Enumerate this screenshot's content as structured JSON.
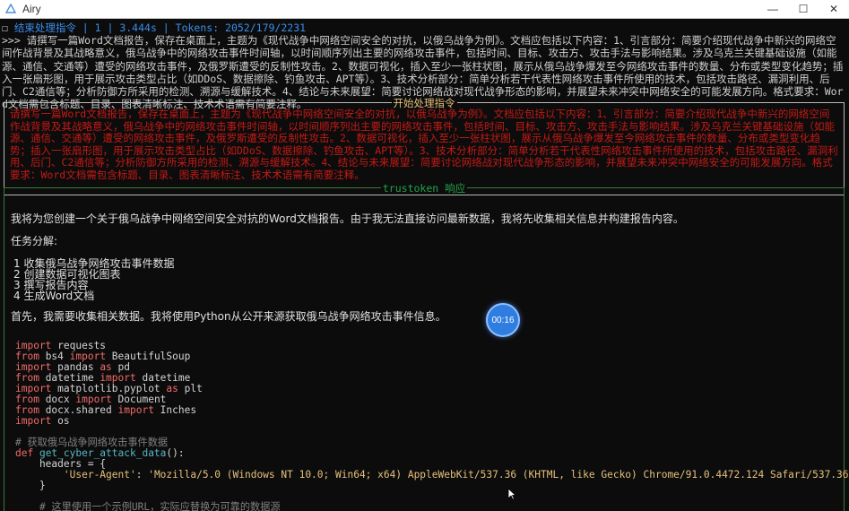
{
  "window": {
    "title": "Airy",
    "minimize": "—",
    "maximize": "☐",
    "close": "✕"
  },
  "status": {
    "box": "☐",
    "text": "结束处理指令 | 1 | 3.444s | Tokens: 2052/179/2231"
  },
  "prompt": {
    "text": ">>> 请撰写一篇Word文档报告，保存在桌面上，主题为《现代战争中网络空间安全的对抗，以俄乌战争为例》。文档应包括以下内容：1、引言部分：简要介绍现代战争中新兴的网络空间作战背景及其战略意义，俄乌战争中的网络攻击事件时间轴，以时间顺序列出主要的网络攻击事件，包括时间、目标、攻击方、攻击手法与影响结果。涉及乌克兰关键基础设施（如能源、通信、交通等）遭受的网络攻击事件，及俄罗斯遭受的反制性攻击。2、数据可视化，插入至少一张柱状图，展示从俄乌战争爆发至今网络攻击事件的数量、分布或类型变化趋势；插入一张扇形图，用于展示攻击类型占比（如DDoS、数据擦除、钓鱼攻击、APT等）。3、技术分析部分：简单分析若干代表性网络攻击事件所使用的技术，包括攻击路径、漏洞利用、后门、C2通信等；分析防御方所采用的检测、溯源与缓解技术。4、结论与未来展望：简要讨论网络战对现代战争形态的影响，并展望未来冲突中网络安全的可能发展方向。格式要求：Word文档需包含标题、目录、图表清晰标注、技术术语需有简要注释。"
  },
  "panel_instruction": {
    "title": "开始处理指令",
    "body": "请撰写一篇Word文档报告，保存在桌面上，主题为《现代战争中网络空间安全的对抗，以俄乌战争为例》。文档应包括以下内容：1、引言部分：简要介绍现代战争中新兴的网络空间作战背景及其战略意义，俄乌战争中的网络攻击事件时间轴，以时间顺序列出主要的网络攻击事件，包括时间、目标、攻击方、攻击手法与影响结果。涉及乌克兰关键基础设施（如能源、通信、交通等）遭受的网络攻击事件，及俄罗斯遭受的反制性攻击。2、数据可视化，插入至少一张柱状图，展示从俄乌战争爆发至今网络攻击事件的数量、分布或类型变化趋势；插入一张扇形图，用于展示攻击类型占比（如DDoS、数据擦除、钓鱼攻击、APT等）。3、技术分析部分：简单分析若干代表性网络攻击事件所使用的技术，包括攻击路径、漏洞利用、后门、C2通信等；分析防御方所采用的检测、溯源与缓解技术。4、结论与未来展望：简要讨论网络战对现代战争形态的影响，并展望未来冲突中网络安全的可能发展方向。格式要求：Word文档需包含标题、目录、图表清晰标注、技术术语需有简要注释。"
  },
  "panel_response": {
    "title": "trustoken 响应",
    "intro": "我将为您创建一个关于俄乌战争中网络空间安全对抗的Word文档报告。由于我无法直接访问最新数据，我将先收集相关信息并构建报告内容。",
    "task_heading": "任务分解:",
    "tasks": [
      "1 收集俄乌战争网络攻击事件数据",
      "2 创建数据可视化图表",
      "3 撰写报告内容",
      "4 生成Word文档"
    ],
    "step_text": "首先，我需要收集相关数据。我将使用Python从公开来源获取俄乌战争网络攻击事件信息。",
    "code": {
      "l1": {
        "kw": "import",
        "rest": " requests"
      },
      "l2": {
        "kw1": "from",
        "mod": " bs4 ",
        "kw2": "import",
        "rest": " BeautifulSoup"
      },
      "l3": {
        "kw": "import",
        "mid": " pandas ",
        "kw2": "as",
        "rest": " pd"
      },
      "l4": {
        "kw1": "from",
        "mod": " datetime ",
        "kw2": "import",
        "rest": " datetime"
      },
      "l5": {
        "kw": "import",
        "mid": " matplotlib.pyplot ",
        "kw2": "as",
        "rest": " plt"
      },
      "l6": {
        "kw1": "from",
        "mod": " docx ",
        "kw2": "import",
        "rest": " Document"
      },
      "l7": {
        "kw1": "from",
        "mod": " docx.shared ",
        "kw2": "import",
        "rest": " Inches"
      },
      "l8": {
        "kw": "import",
        "rest": " os"
      },
      "comment1": "# 获取俄乌战争网络攻击事件数据",
      "def_kw": "def",
      "def_name": " get_cyber_attack_data",
      "def_rest": "():",
      "headers_line": "    headers = {",
      "ua_key": "'User-Agent'",
      "ua_sep": ": ",
      "ua_val": "'Mozilla/5.0 (Windows NT 10.0; Win64; x64) AppleWebKit/537.36 (KHTML, like Gecko) Chrome/91.0.4472.124 Safari/537.36'",
      "close_brace": "    }",
      "comment2": "# 这里使用一个示例URL，实际应替换为可靠的数据源"
    }
  },
  "timer": {
    "label": "00:16"
  },
  "colors": {
    "accent_blue": "#3b8eea",
    "instruction_red": "#c41a16",
    "response_green": "#23a34a",
    "title_yellow": "#e5c07b"
  }
}
